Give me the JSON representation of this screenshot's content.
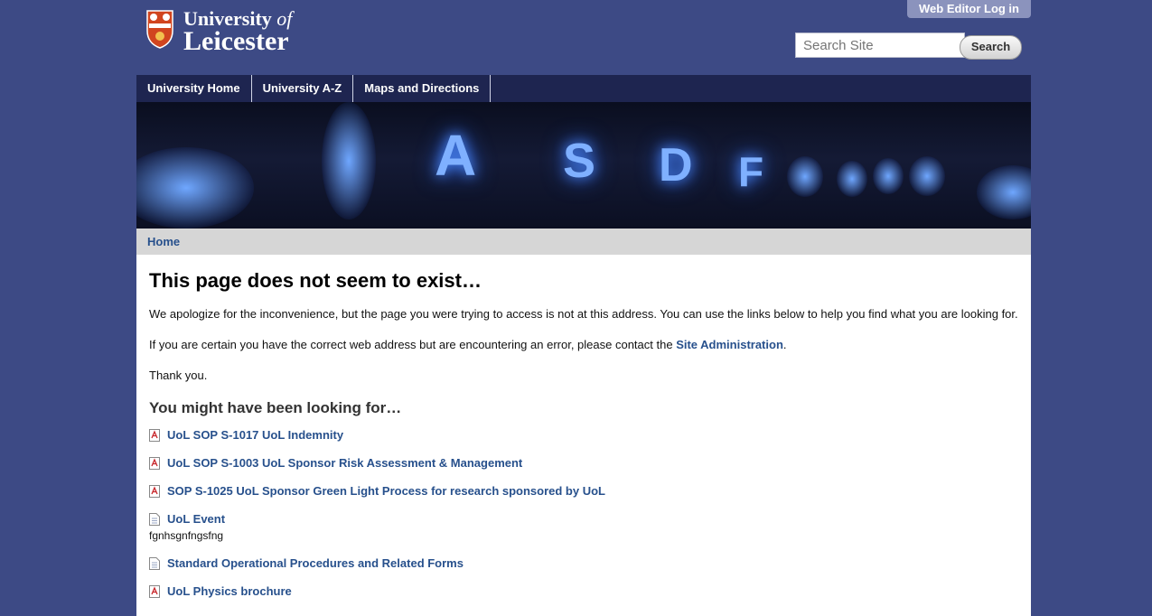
{
  "header": {
    "logo_line1": "University",
    "logo_of": "of",
    "logo_line2": "Leicester",
    "web_editor_login": "Web Editor Log in",
    "search_placeholder": "Search Site",
    "search_button": "Search"
  },
  "nav": {
    "items": [
      "University Home",
      "University A-Z",
      "Maps and Directions"
    ]
  },
  "breadcrumb": {
    "home": "Home"
  },
  "main": {
    "title": "This page does not seem to exist…",
    "para1": "We apologize for the inconvenience, but the page you were trying to access is not at this address. You can use the links below to help you find what you are looking for.",
    "para2_prefix": "If you are certain you have the correct web address but are encountering an error, please contact the ",
    "para2_link": "Site Administration",
    "para2_suffix": ".",
    "thanks": "Thank you.",
    "subtitle": "You might have been looking for…",
    "results": [
      {
        "title": "UoL SOP S-1017 UoL Indemnity",
        "icon": "pdf-icon",
        "desc": ""
      },
      {
        "title": "UoL SOP S-1003 UoL Sponsor Risk Assessment & Management",
        "icon": "pdf-icon",
        "desc": ""
      },
      {
        "title": "SOP S-1025 UoL Sponsor Green Light Process for research sponsored by UoL",
        "icon": "pdf-icon",
        "desc": ""
      },
      {
        "title": "UoL Event",
        "icon": "page-icon",
        "desc": "fgnhsgnfngsfng"
      },
      {
        "title": "Standard Operational Procedures and Related Forms",
        "icon": "page-icon",
        "desc": ""
      },
      {
        "title": "UoL Physics brochure",
        "icon": "pdf-icon",
        "desc": ""
      }
    ]
  },
  "banner": {
    "keys": [
      "A",
      "S",
      "D",
      "F"
    ]
  },
  "colors": {
    "background": "#3d4a85",
    "nav": "#1e2550",
    "link": "#27508c"
  }
}
